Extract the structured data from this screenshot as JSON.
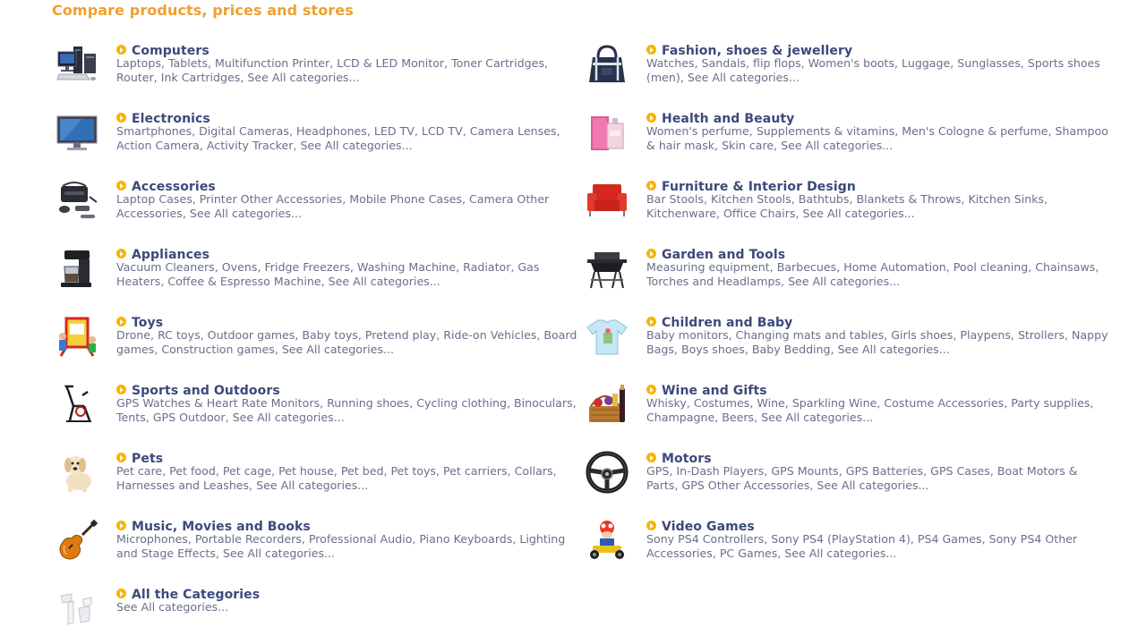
{
  "page": {
    "title": "Compare products, prices and stores",
    "title_color": "#f0a030",
    "category_color": "#3b4a7a",
    "link_color": "#6a6f8a",
    "bullet_color": "#f8b400"
  },
  "categories": [
    {
      "name": "Computers",
      "icon": "computer-desktop-icon",
      "links": [
        "Laptops",
        "Tablets",
        "Multifunction Printer",
        "LCD & LED Monitor",
        "Toner Cartridges",
        "Router",
        "Ink Cartridges"
      ],
      "see_all": "See All categories..."
    },
    {
      "name": "Fashion, shoes & jewellery",
      "icon": "handbag-icon",
      "links": [
        "Watches",
        "Sandals",
        "flip flops",
        "Women's boots",
        "Luggage",
        "Sunglasses",
        "Sports shoes (men)"
      ],
      "see_all": "See All categories..."
    },
    {
      "name": "Electronics",
      "icon": "television-icon",
      "links": [
        "Smartphones",
        "Digital Cameras",
        "Headphones",
        "LED TV",
        "LCD TV",
        "Camera Lenses",
        "Action Camera",
        "Activity Tracker"
      ],
      "see_all": "See All categories..."
    },
    {
      "name": "Health and Beauty",
      "icon": "perfume-box-icon",
      "links": [
        "Women's perfume",
        "Supplements & vitamins",
        "Men's Cologne & perfume",
        "Shampoo & hair mask",
        "Skin care"
      ],
      "see_all": "See All categories..."
    },
    {
      "name": "Accessories",
      "icon": "camera-bag-icon",
      "links": [
        "Laptop Cases",
        "Printer Other Accessories",
        "Mobile Phone Cases",
        "Camera Other Accessories"
      ],
      "see_all": "See All categories..."
    },
    {
      "name": "Furniture & Interior Design",
      "icon": "armchair-icon",
      "links": [
        "Bar Stools",
        "Kitchen Stools",
        "Bathtubs",
        "Blankets & Throws",
        "Kitchen Sinks",
        "Kitchenware",
        "Office Chairs"
      ],
      "see_all": "See All categories..."
    },
    {
      "name": "Appliances",
      "icon": "coffee-maker-icon",
      "links": [
        "Vacuum Cleaners",
        "Ovens",
        "Fridge Freezers",
        "Washing Machine",
        "Radiator",
        "Gas Heaters",
        "Coffee & Espresso Machine"
      ],
      "see_all": "See All categories..."
    },
    {
      "name": "Garden and Tools",
      "icon": "barbecue-grill-icon",
      "links": [
        "Measuring equipment",
        "Barbecues",
        "Home Automation",
        "Pool cleaning",
        "Chainsaws",
        "Torches and Headlamps"
      ],
      "see_all": "See All categories..."
    },
    {
      "name": "Toys",
      "icon": "toy-easel-icon",
      "links": [
        "Drone",
        "RC toys",
        "Outdoor games",
        "Baby toys",
        "Pretend play",
        "Ride-on Vehicles",
        "Board games",
        "Construction games"
      ],
      "see_all": "See All categories..."
    },
    {
      "name": "Children and Baby",
      "icon": "baby-shirt-icon",
      "links": [
        "Baby monitors",
        "Changing mats and tables",
        "Girls shoes",
        "Playpens",
        "Strollers",
        "Nappy Bags",
        "Boys shoes",
        "Baby Bedding"
      ],
      "see_all": "See All categories..."
    },
    {
      "name": "Sports and Outdoors",
      "icon": "exercise-bike-icon",
      "links": [
        "GPS Watches & Heart Rate Monitors",
        "Running shoes",
        "Cycling clothing",
        "Binoculars",
        "Tents",
        "GPS Outdoor"
      ],
      "see_all": "See All categories..."
    },
    {
      "name": "Wine and Gifts",
      "icon": "wine-gift-basket-icon",
      "links": [
        "Whisky",
        "Costumes",
        "Wine",
        "Sparkling Wine",
        "Costume Accessories",
        "Party supplies",
        "Champagne",
        "Beers"
      ],
      "see_all": "See All categories..."
    },
    {
      "name": "Pets",
      "icon": "puppy-icon",
      "links": [
        "Pet care",
        "Pet food",
        "Pet cage",
        "Pet house",
        "Pet bed",
        "Pet toys",
        "Pet carriers",
        "Collars",
        "Harnesses and Leashes"
      ],
      "see_all": "See All categories..."
    },
    {
      "name": "Motors",
      "icon": "steering-wheel-icon",
      "links": [
        "GPS",
        "In-Dash Players",
        "GPS Mounts",
        "GPS Batteries",
        "GPS Cases",
        "Boat Motors & Parts",
        "GPS Other Accessories"
      ],
      "see_all": "See All categories..."
    },
    {
      "name": "Music, Movies and Books",
      "icon": "electric-guitar-icon",
      "links": [
        "Microphones",
        "Portable Recorders",
        "Professional Audio",
        "Piano Keyboards",
        "Lighting and Stage Effects"
      ],
      "see_all": "See All categories..."
    },
    {
      "name": "Video Games",
      "icon": "kart-racer-icon",
      "links": [
        "Sony PS4 Controllers",
        "Sony PS4 (PlayStation 4)",
        "PS4 Games",
        "Sony PS4 Other Accessories",
        "PC Games"
      ],
      "see_all": "See All categories..."
    },
    {
      "name": "All the Categories",
      "icon": "all-categories-icon",
      "links": [],
      "see_all": "See All categories..."
    }
  ]
}
